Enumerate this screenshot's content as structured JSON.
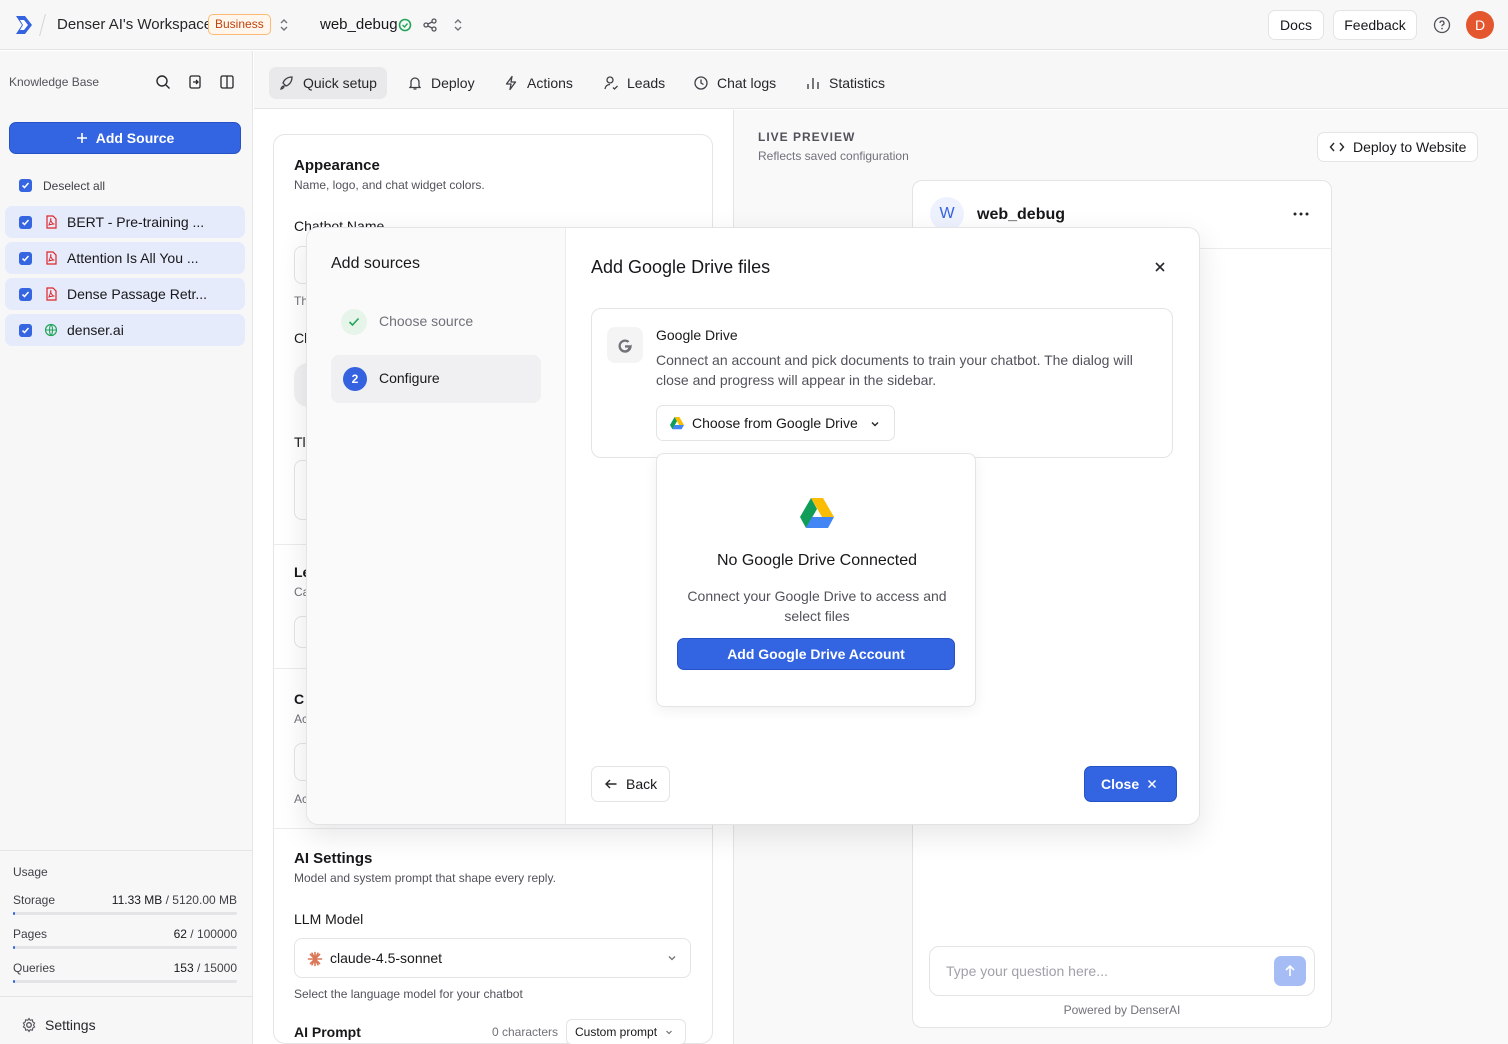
{
  "topbar": {
    "workspace": "Denser AI's Workspace",
    "plan_badge": "Business",
    "project": "web_debug",
    "docs": "Docs",
    "feedback": "Feedback",
    "avatar_initial": "D"
  },
  "sidebar": {
    "title": "Knowledge Base",
    "add_source": "Add Source",
    "deselect_all": "Deselect all",
    "sources": [
      {
        "label": "BERT - Pre-training ...",
        "icon": "pdf-icon"
      },
      {
        "label": "Attention Is All You ...",
        "icon": "pdf-icon"
      },
      {
        "label": "Dense Passage Retr...",
        "icon": "pdf-icon"
      },
      {
        "label": "denser.ai",
        "icon": "globe-icon"
      }
    ],
    "usage": {
      "title": "Usage",
      "storage_label": "Storage",
      "storage_used": "11.33 MB",
      "storage_total": " / 5120.00 MB",
      "storage_fraction": 0.0022,
      "pages_label": "Pages",
      "pages_used": "62",
      "pages_total": " / 100000",
      "pages_fraction": 0.0006,
      "queries_label": "Queries",
      "queries_used": "153",
      "queries_total": " / 15000",
      "queries_fraction": 0.0102
    },
    "settings": "Settings"
  },
  "tabs": [
    {
      "label": "Quick setup",
      "icon": "rocket-icon",
      "active": true
    },
    {
      "label": "Deploy",
      "icon": "bell-icon"
    },
    {
      "label": "Actions",
      "icon": "bolt-icon"
    },
    {
      "label": "Leads",
      "icon": "user-icon"
    },
    {
      "label": "Chat logs",
      "icon": "clock-icon"
    },
    {
      "label": "Statistics",
      "icon": "bar-chart-icon"
    }
  ],
  "settings_panel": {
    "appearance_title": "Appearance",
    "appearance_desc": "Name, logo, and chat widget colors.",
    "chatbot_name_label": "Chatbot Name",
    "partial_th": "Th",
    "partial_c1": "Cl",
    "partial_t": "Tl",
    "partial_le": "Le",
    "partial_ca": "Ca",
    "partial_c2": "C",
    "partial_ac1": "Ac",
    "partial_ac2": "Ac",
    "ai_settings_title": "AI Settings",
    "ai_settings_desc": "Model and system prompt that shape every reply.",
    "llm_label": "LLM Model",
    "llm_value": "claude-4.5-sonnet",
    "llm_help": "Select the language model for your chatbot",
    "prompt_label": "AI Prompt",
    "prompt_chars": "0 characters",
    "prompt_mode": "Custom prompt"
  },
  "preview": {
    "title": "LIVE PREVIEW",
    "subtitle": "Reflects saved configuration",
    "deploy_btn": "Deploy to Website",
    "bot_initial": "W",
    "bot_name": "web_debug",
    "input_placeholder": "Type your question here...",
    "powered_by": "Powered by DenserAI"
  },
  "modal": {
    "left_title": "Add sources",
    "step1": "Choose source",
    "step2_num": "2",
    "step2": "Configure",
    "title": "Add Google Drive files",
    "gd_title": "Google Drive",
    "gd_desc": "Connect an account and pick documents to train your chatbot. The dialog will close and progress will appear in the sidebar.",
    "choose_btn": "Choose from Google Drive",
    "empty_title": "No Google Drive Connected",
    "empty_desc": "Connect your Google Drive to access and select files",
    "add_account_btn": "Add Google Drive Account",
    "back_btn": "Back",
    "close_btn": "Close"
  }
}
